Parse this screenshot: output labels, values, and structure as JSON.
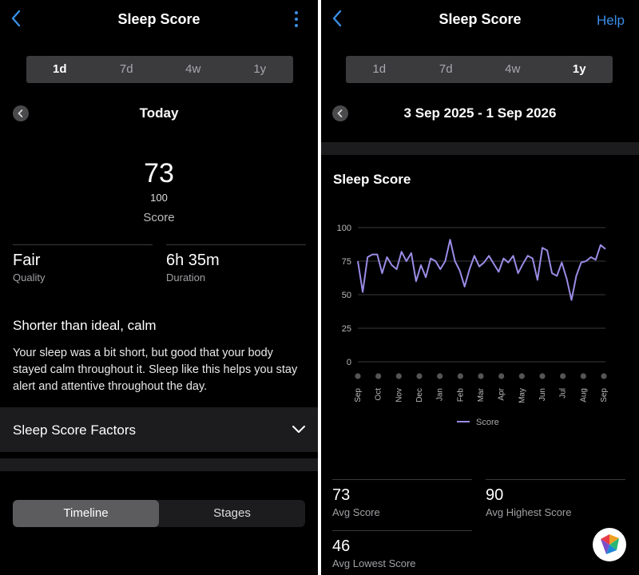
{
  "left": {
    "header": {
      "title": "Sleep Score"
    },
    "range_tabs": [
      "1d",
      "7d",
      "4w",
      "1y"
    ],
    "selected_tab": "1d",
    "period": "Today",
    "score": {
      "value": "73",
      "max": "100",
      "label": "Score"
    },
    "stats": [
      {
        "value": "Fair",
        "caption": "Quality"
      },
      {
        "value": "6h 35m",
        "caption": "Duration"
      }
    ],
    "insight": {
      "title": "Shorter than ideal, calm",
      "body": "Your sleep was a bit short, but good that your body stayed calm throughout it. Sleep like this helps you stay alert and attentive throughout the day."
    },
    "factors_label": "Sleep Score Factors",
    "view_tabs": [
      "Timeline",
      "Stages"
    ],
    "selected_view": "Timeline"
  },
  "right": {
    "header": {
      "title": "Sleep Score",
      "help": "Help"
    },
    "range_tabs": [
      "1d",
      "7d",
      "4w",
      "1y"
    ],
    "selected_tab": "1y",
    "period": "3 Sep 2025 - 1 Sep 2026",
    "chart_title": "Sleep Score",
    "summary": [
      {
        "value": "73",
        "caption": "Avg Score"
      },
      {
        "value": "90",
        "caption": "Avg Highest Score"
      },
      {
        "value": "46",
        "caption": "Avg Lowest Score"
      }
    ]
  },
  "chart_data": {
    "type": "line",
    "title": "Sleep Score",
    "xlabel": "",
    "ylabel": "",
    "ylim": [
      0,
      100
    ],
    "yticks": [
      0,
      25,
      50,
      75,
      100
    ],
    "x_tick_labels": [
      "Sep",
      "Oct",
      "Nov",
      "Dec",
      "Jan",
      "Feb",
      "Mar",
      "Apr",
      "May",
      "Jun",
      "Jul",
      "Aug",
      "Sep"
    ],
    "grid": true,
    "legend": "bottom",
    "series": [
      {
        "name": "Score",
        "color": "#9a8ce6",
        "values": [
          75,
          52,
          78,
          80,
          80,
          66,
          78,
          72,
          69,
          82,
          75,
          81,
          60,
          72,
          63,
          77,
          75,
          69,
          75,
          91,
          75,
          68,
          56,
          69,
          79,
          71,
          74,
          79,
          73,
          67,
          77,
          74,
          79,
          66,
          73,
          79,
          77,
          61,
          85,
          83,
          66,
          64,
          74,
          62,
          46,
          64,
          74,
          75,
          78,
          76,
          87,
          84
        ]
      }
    ]
  }
}
